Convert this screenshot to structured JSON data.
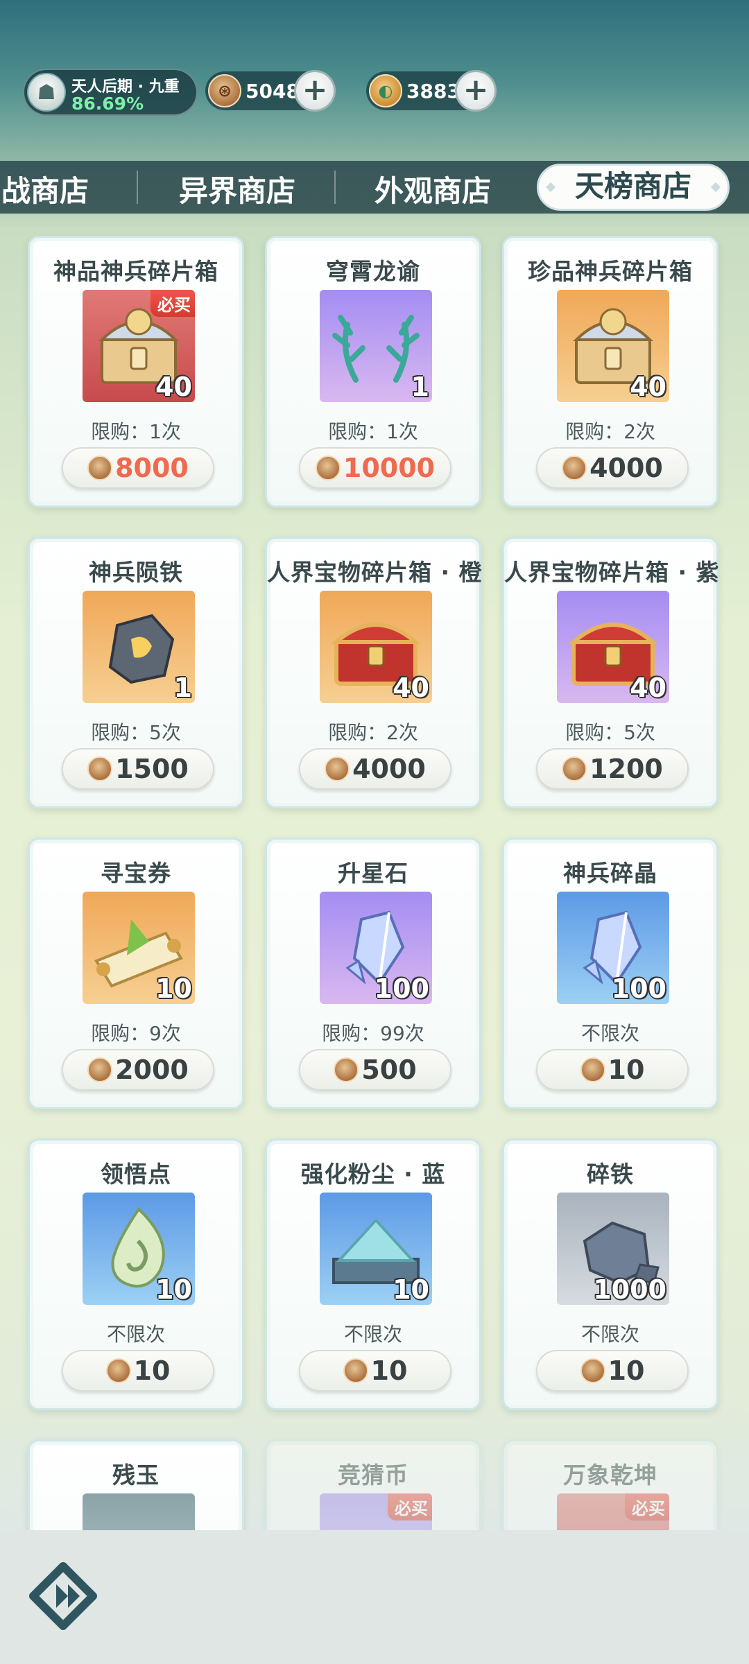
{
  "player": {
    "rank": "天人后期 · 九重",
    "progress": "86.69%"
  },
  "currencies": [
    {
      "icon": "coin-icon",
      "value": "5048"
    },
    {
      "icon": "jade-icon",
      "value": "3883"
    }
  ],
  "tabs": [
    {
      "label": "助战商店",
      "active": false
    },
    {
      "label": "异界商店",
      "active": false
    },
    {
      "label": "外观商店",
      "active": false
    },
    {
      "label": "天榜商店",
      "active": true
    }
  ],
  "items": [
    {
      "name": "神品神兵碎片箱",
      "qty": "40",
      "badge": "必买",
      "limit": "限购：1次",
      "price": "8000",
      "price_red": true,
      "bg": "red",
      "icon": "dragon-chest-icon"
    },
    {
      "name": "穹霄龙谕",
      "qty": "1",
      "badge": "",
      "limit": "限购：1次",
      "price": "10000",
      "price_red": true,
      "bg": "purple",
      "icon": "dragon-antlers-icon"
    },
    {
      "name": "珍品神兵碎片箱",
      "qty": "40",
      "badge": "",
      "limit": "限购：2次",
      "price": "4000",
      "price_red": false,
      "bg": "orange",
      "icon": "dragon-chest-icon"
    },
    {
      "name": "神兵陨铁",
      "qty": "1",
      "badge": "",
      "limit": "限购：5次",
      "price": "1500",
      "price_red": false,
      "bg": "orange",
      "icon": "meteorite-icon"
    },
    {
      "name": "人界宝物碎片箱 · 橙",
      "qty": "40",
      "badge": "",
      "limit": "限购：2次",
      "price": "4000",
      "price_red": false,
      "bg": "orange",
      "icon": "treasure-chest-icon"
    },
    {
      "name": "人界宝物碎片箱 · 紫",
      "qty": "40",
      "badge": "",
      "limit": "限购：5次",
      "price": "1200",
      "price_red": false,
      "bg": "purple",
      "icon": "treasure-chest-icon"
    },
    {
      "name": "寻宝券",
      "qty": "10",
      "badge": "",
      "limit": "限购：9次",
      "price": "2000",
      "price_red": false,
      "bg": "orange",
      "icon": "scroll-icon"
    },
    {
      "name": "升星石",
      "qty": "100",
      "badge": "",
      "limit": "限购：99次",
      "price": "500",
      "price_red": false,
      "bg": "purple",
      "icon": "crystal-icon"
    },
    {
      "name": "神兵碎晶",
      "qty": "100",
      "badge": "",
      "limit": "不限次",
      "price": "10",
      "price_red": false,
      "bg": "blue",
      "icon": "crystal-icon"
    },
    {
      "name": "领悟点",
      "qty": "10",
      "badge": "",
      "limit": "不限次",
      "price": "10",
      "price_red": false,
      "bg": "blue",
      "icon": "jade-swirl-icon"
    },
    {
      "name": "强化粉尘 · 蓝",
      "qty": "10",
      "badge": "",
      "limit": "不限次",
      "price": "10",
      "price_red": false,
      "bg": "blue",
      "icon": "dust-pile-icon"
    },
    {
      "name": "碎铁",
      "qty": "1000",
      "badge": "",
      "limit": "不限次",
      "price": "10",
      "price_red": false,
      "bg": "gray",
      "icon": "iron-ore-icon"
    },
    {
      "name": "残玉",
      "qty": "",
      "badge": "",
      "limit": "",
      "price": "",
      "price_red": false,
      "bg": "teal",
      "icon": "jade-shard-icon",
      "faded": false
    },
    {
      "name": "竞猜币",
      "qty": "",
      "badge": "必买",
      "limit": "",
      "price": "",
      "price_red": false,
      "bg": "purple",
      "icon": "guess-coin-icon",
      "faded": true
    },
    {
      "name": "万象乾坤",
      "qty": "",
      "badge": "必买",
      "limit": "",
      "price": "",
      "price_red": false,
      "bg": "red",
      "icon": "frame-icon",
      "faded": true
    }
  ]
}
